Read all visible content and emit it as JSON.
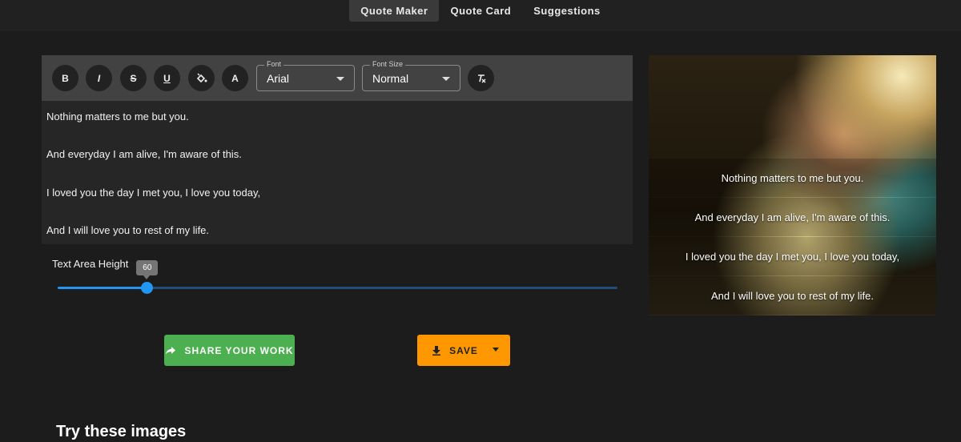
{
  "nav": {
    "tabs": [
      {
        "label": "Quote Maker",
        "active": true
      },
      {
        "label": "Quote Card",
        "active": false
      },
      {
        "label": "Suggestions",
        "active": false
      }
    ]
  },
  "toolbar": {
    "bold": "B",
    "italic": "I",
    "strike": "S",
    "underline": "U",
    "text_color": "A",
    "font": {
      "label": "Font",
      "value": "Arial"
    },
    "font_size": {
      "label": "Font Size",
      "value": "Normal"
    }
  },
  "quote": {
    "lines": [
      "Nothing matters to me but you.",
      "And everyday I am alive, I'm aware of this.",
      "I loved you the day I met you, I love you today,",
      "And I will love you to rest of my life."
    ]
  },
  "slider": {
    "label": "Text Area Height",
    "value": "60",
    "fraction": 0.16
  },
  "actions": {
    "share_label": "SHARE YOUR WORK",
    "save_label": "SAVE"
  },
  "section": {
    "title": "Try these images"
  },
  "colors": {
    "share": "#4caf50",
    "save": "#ff9800",
    "slider": "#2196f3"
  }
}
